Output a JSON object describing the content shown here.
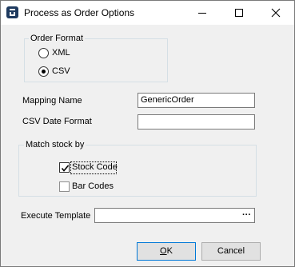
{
  "window": {
    "title": "Process as Order Options"
  },
  "order_format": {
    "legend": "Order Format",
    "options": [
      {
        "label": "XML",
        "selected": false
      },
      {
        "label": "CSV",
        "selected": true
      }
    ]
  },
  "mapping_name": {
    "label": "Mapping Name",
    "value": "GenericOrder"
  },
  "csv_date_format": {
    "label": "CSV Date Format",
    "value": ""
  },
  "match_stock_by": {
    "legend": "Match stock by",
    "options": [
      {
        "label": "Stock Code",
        "checked": true
      },
      {
        "label": "Bar Codes",
        "checked": false
      }
    ]
  },
  "execute_template": {
    "label": "Execute Template",
    "value": "",
    "browse_label": "···"
  },
  "buttons": {
    "ok_mnemonic": "O",
    "ok_rest": "K",
    "cancel_label": "Cancel"
  }
}
